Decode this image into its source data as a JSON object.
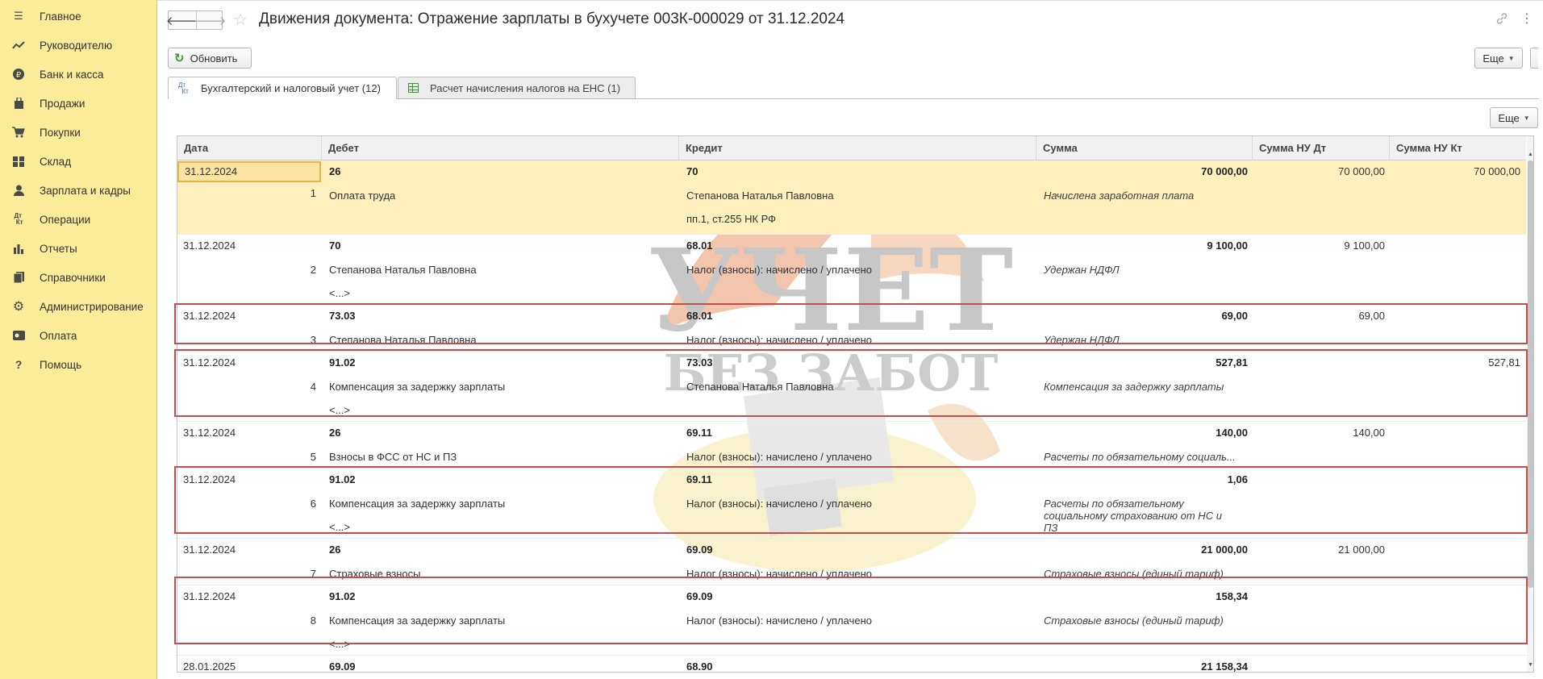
{
  "sidebar": {
    "items": [
      {
        "label": "Главное",
        "icon": "menu-icon"
      },
      {
        "label": "Руководителю",
        "icon": "trend-icon"
      },
      {
        "label": "Банк и касса",
        "icon": "ruble-icon"
      },
      {
        "label": "Продажи",
        "icon": "bag-icon"
      },
      {
        "label": "Покупки",
        "icon": "cart-icon"
      },
      {
        "label": "Склад",
        "icon": "warehouse-icon"
      },
      {
        "label": "Зарплата и кадры",
        "icon": "person-icon"
      },
      {
        "label": "Операции",
        "icon": "dtkt-icon"
      },
      {
        "label": "Отчеты",
        "icon": "bar-chart-icon"
      },
      {
        "label": "Справочники",
        "icon": "books-icon"
      },
      {
        "label": "Администрирование",
        "icon": "gear-icon"
      },
      {
        "label": "Оплата",
        "icon": "wallet-icon"
      },
      {
        "label": "Помощь",
        "icon": "help-icon"
      }
    ]
  },
  "header": {
    "back": "🡐",
    "forward": "🡒",
    "title": "Движения документа: Отражение зарплаты в бухучете 003К-000029 от 31.12.2024",
    "more_icon": "⋮"
  },
  "toolbar": {
    "refresh_label": "Обновить",
    "more_label": "Еще",
    "more_label_2": "Еще"
  },
  "tabs": [
    {
      "label": "Бухгалтерский и налоговый учет (12)"
    },
    {
      "label": "Расчет начисления налогов на ЕНС (1)"
    }
  ],
  "table": {
    "columns": [
      "Дата",
      "Дебет",
      "Кредит",
      "Сумма",
      "Сумма НУ Дт",
      "Сумма НУ Кт"
    ],
    "rows": [
      {
        "date": "31.12.2024",
        "n": "1",
        "debit": "26",
        "debit_sub": "Оплата труда",
        "debit_sub2": "",
        "credit": "70",
        "credit_sub": "Степанова Наталья Павловна",
        "credit_sub2": "пп.1, ст.255 НК РФ",
        "sum": "70 000,00",
        "sum_desc": "Начислена заработная плата",
        "nu_dt": "70 000,00",
        "nu_kt": "70 000,00"
      },
      {
        "date": "31.12.2024",
        "n": "2",
        "debit": "70",
        "debit_sub": "Степанова Наталья Павловна",
        "debit_sub2": "<...>",
        "credit": "68.01",
        "credit_sub": "Налог (взносы): начислено / уплачено",
        "credit_sub2": "",
        "sum": "9 100,00",
        "sum_desc": "Удержан НДФЛ",
        "nu_dt": "9 100,00",
        "nu_kt": ""
      },
      {
        "date": "31.12.2024",
        "n": "3",
        "debit": "73.03",
        "debit_sub": "Степанова Наталья Павловна",
        "debit_sub2": "",
        "credit": "68.01",
        "credit_sub": "Налог (взносы): начислено / уплачено",
        "credit_sub2": "",
        "sum": "69,00",
        "sum_desc": "Удержан НДФЛ",
        "nu_dt": "69,00",
        "nu_kt": ""
      },
      {
        "date": "31.12.2024",
        "n": "4",
        "debit": "91.02",
        "debit_sub": "Компенсация за задержку зарплаты",
        "debit_sub2": "<...>",
        "credit": "73.03",
        "credit_sub": "Степанова Наталья Павловна",
        "credit_sub2": "",
        "sum": "527,81",
        "sum_desc": "Компенсация за задержку зарплаты",
        "nu_dt": "",
        "nu_kt": "527,81"
      },
      {
        "date": "31.12.2024",
        "n": "5",
        "debit": "26",
        "debit_sub": "Взносы в ФСС от НС и ПЗ",
        "debit_sub2": "",
        "credit": "69.11",
        "credit_sub": "Налог (взносы): начислено / уплачено",
        "credit_sub2": "",
        "sum": "140,00",
        "sum_desc": "Расчеты по обязательному социаль...",
        "nu_dt": "140,00",
        "nu_kt": ""
      },
      {
        "date": "31.12.2024",
        "n": "6",
        "debit": "91.02",
        "debit_sub": "Компенсация за задержку зарплаты",
        "debit_sub2": "<...>",
        "credit": "69.11",
        "credit_sub": "Налог (взносы): начислено / уплачено",
        "credit_sub2": "",
        "sum": "1,06",
        "sum_desc": "Расчеты по обязательному социальному страхованию от НС и ПЗ",
        "nu_dt": "",
        "nu_kt": ""
      },
      {
        "date": "31.12.2024",
        "n": "7",
        "debit": "26",
        "debit_sub": "Страховые взносы",
        "debit_sub2": "",
        "credit": "69.09",
        "credit_sub": "Налог (взносы): начислено / уплачено",
        "credit_sub2": "",
        "sum": "21 000,00",
        "sum_desc": "Страховые взносы (единый тариф)",
        "nu_dt": "21 000,00",
        "nu_kt": ""
      },
      {
        "date": "31.12.2024",
        "n": "8",
        "debit": "91.02",
        "debit_sub": "Компенсация за задержку зарплаты",
        "debit_sub2": "<...>",
        "credit": "69.09",
        "credit_sub": "Налог (взносы): начислено / уплачено",
        "credit_sub2": "",
        "sum": "158,34",
        "sum_desc": "Страховые взносы (единый тариф)",
        "nu_dt": "",
        "nu_kt": ""
      },
      {
        "date": "28.01.2025",
        "n": "",
        "debit": "69.09",
        "debit_sub": "",
        "debit_sub2": "",
        "credit": "68.90",
        "credit_sub": "",
        "credit_sub2": "",
        "sum": "21 158,34",
        "sum_desc": "",
        "nu_dt": "",
        "nu_kt": ""
      }
    ]
  },
  "watermark": {
    "line1": "УЧЕТ",
    "line2": "БЕЗ ЗАБОТ"
  },
  "colors": {
    "sidebar_bg": "#fbec9a",
    "selected_row": "#fdf0bd",
    "highlight_border": "#c0504d",
    "refresh_icon": "#3a9a35"
  }
}
